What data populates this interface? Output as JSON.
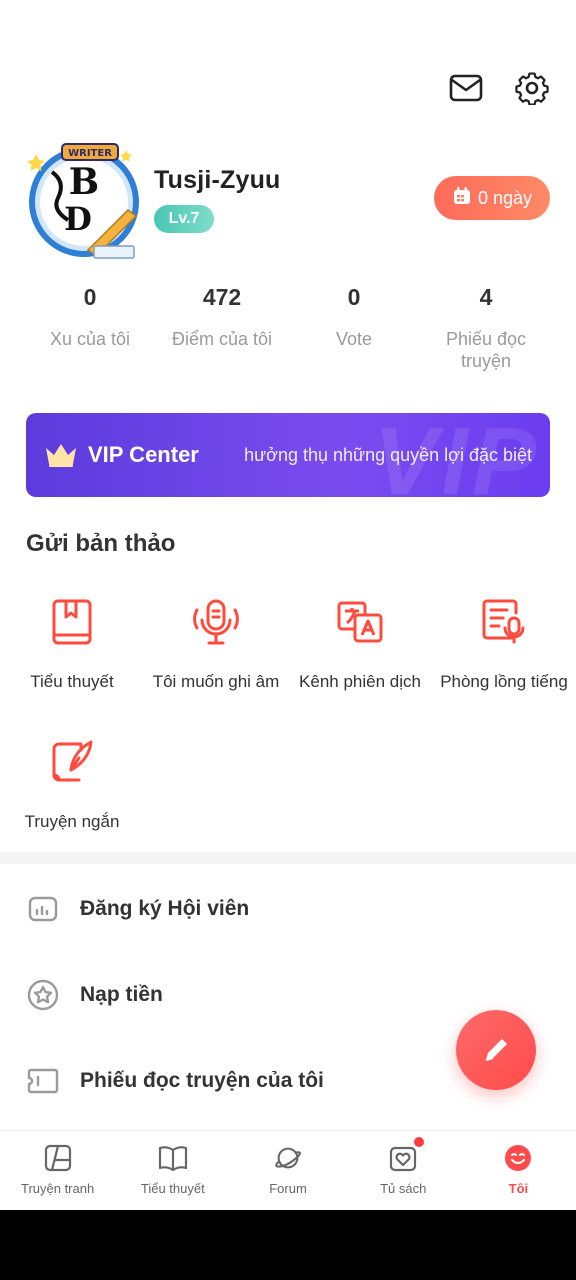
{
  "header": {
    "mail_icon": "mail-icon",
    "settings_icon": "gear-icon"
  },
  "profile": {
    "username": "Tusji-Zyuu",
    "level": "Lv.7",
    "avatar_text": "WRITER",
    "checkin_label": "0 ngày"
  },
  "stats": [
    {
      "value": "0",
      "label": "Xu của tôi"
    },
    {
      "value": "472",
      "label": "Điểm của tôi"
    },
    {
      "value": "0",
      "label": "Vote"
    },
    {
      "value": "4",
      "label": "Phiếu đọc truyện"
    }
  ],
  "vip": {
    "title": "VIP Center",
    "subtitle": "hưởng thụ những quyền lợi đặc biệt",
    "watermark": "VIP"
  },
  "submit_section": {
    "title": "Gửi bản thảo",
    "items": [
      {
        "label": "Tiểu thuyết",
        "icon": "book-icon"
      },
      {
        "label": "Tôi muốn ghi âm",
        "icon": "microphone-icon"
      },
      {
        "label": "Kênh phiên dịch",
        "icon": "translate-icon"
      },
      {
        "label": "Phòng lồng tiếng",
        "icon": "dubbing-icon"
      },
      {
        "label": "Truyện ngắn",
        "icon": "quill-icon"
      }
    ]
  },
  "menu": [
    {
      "label": "Đăng ký Hội viên",
      "icon": "membership-icon"
    },
    {
      "label": "Nạp tiền",
      "icon": "star-coin-icon"
    },
    {
      "label": "Phiếu đọc truyện của tôi",
      "icon": "ticket-icon"
    }
  ],
  "bottom_nav": [
    {
      "label": "Truyện tranh",
      "icon": "comic-icon",
      "active": false
    },
    {
      "label": "Tiểu thuyết",
      "icon": "open-book-icon",
      "active": false
    },
    {
      "label": "Forum",
      "icon": "planet-icon",
      "active": false
    },
    {
      "label": "Tủ sách",
      "icon": "bookshelf-heart-icon",
      "active": false,
      "badge": true
    },
    {
      "label": "Tôi",
      "icon": "smiley-icon",
      "active": true
    }
  ],
  "colors": {
    "accent": "#ff4b4b",
    "vip_gradient_start": "#5c3bdc",
    "level_badge": "#49c6b7",
    "checkin": "#ff6b5a"
  }
}
